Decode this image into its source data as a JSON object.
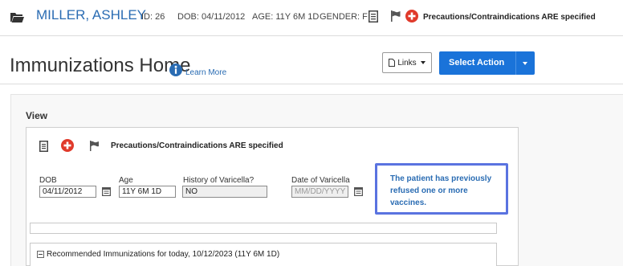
{
  "patient": {
    "name": "MILLER, ASHLEY",
    "id": "ID: 26",
    "dob": "DOB: 04/11/2012",
    "age": "AGE: 11Y 6M 1D",
    "gender": "GENDER: F",
    "precautions": "Precautions/Contraindications ARE specified"
  },
  "header": {
    "title": "Immunizations Home",
    "learn_more": "Learn More",
    "links_label": "Links",
    "select_action_label": "Select Action"
  },
  "view": {
    "heading": "View",
    "precautions": "Precautions/Contraindications ARE specified",
    "fields": {
      "dob": {
        "label": "DOB",
        "value": "04/11/2012"
      },
      "age": {
        "label": "Age",
        "value": "11Y 6M 1D"
      },
      "varicella_history": {
        "label": "History of Varicella?",
        "value": "NO"
      },
      "varicella_date": {
        "label": "Date of Varicella",
        "placeholder": "MM/DD/YYYY"
      }
    },
    "alert": "The patient has previously refused one or more vaccines.",
    "recommended": "Recommended Immunizations for today, 10/12/2023 (11Y 6M 1D)"
  },
  "colors": {
    "link_blue": "#2a6cb3",
    "primary_button": "#1a73d9",
    "alert_border": "#5a73e0",
    "red_plus": "#e03a2b"
  },
  "icons": [
    "folder-icon",
    "document-icon",
    "flag-icon",
    "plus-circle-icon",
    "info-icon",
    "calendar-icon",
    "minus-square-icon"
  ]
}
